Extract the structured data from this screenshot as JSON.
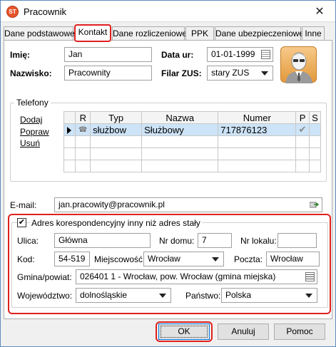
{
  "window": {
    "title": "Pracownik",
    "app_icon": "ST"
  },
  "tabs": [
    "Dane podstawowe",
    "Kontakt",
    "Dane rozliczeniowe",
    "PPK",
    "Dane ubezpieczeniowe",
    "Inne"
  ],
  "person": {
    "first_name_label": "Imię:",
    "first_name": "Jan",
    "last_name_label": "Nazwisko:",
    "last_name": "Pracownity",
    "birth_date_label": "Data ur:",
    "birth_date": "01-01-1999",
    "zus_label": "Filar ZUS:",
    "zus_value": "stary ZUS"
  },
  "phones": {
    "group_label": "Telefony",
    "actions": [
      "Dodaj",
      "Popraw",
      "Usuń"
    ],
    "columns": [
      "R",
      "Typ",
      "Nazwa",
      "Numer",
      "P",
      "S"
    ],
    "rows": [
      {
        "typ": "służbow",
        "nazwa": "Służbowy",
        "numer": "717876123",
        "p": "✔",
        "s": ""
      }
    ]
  },
  "email": {
    "label": "E-mail:",
    "value": "jan.pracowity@pracownik.pl"
  },
  "address": {
    "checkbox_label": "Adres korespondencyjny inny niż adres stały",
    "checked": true,
    "street_label": "Ulica:",
    "street": "Główna",
    "house_label": "Nr domu:",
    "house": "7",
    "flat_label": "Nr lokalu:",
    "flat": "",
    "postcode_label": "Kod:",
    "postcode": "54-519",
    "city_label": "Miejscowość:",
    "city": "Wrocław",
    "post_label": "Poczta:",
    "post": "Wrocław",
    "commune_label": "Gmina/powiat:",
    "commune": "026401 1 - Wrocław, pow. Wrocław (gmina miejska)",
    "voivodeship_label": "Województwo:",
    "voivodeship": "dolnośląskie",
    "country_label": "Państwo:",
    "country": "Polska"
  },
  "buttons": {
    "ok": "OK",
    "cancel": "Anuluj",
    "help": "Pomoc"
  }
}
